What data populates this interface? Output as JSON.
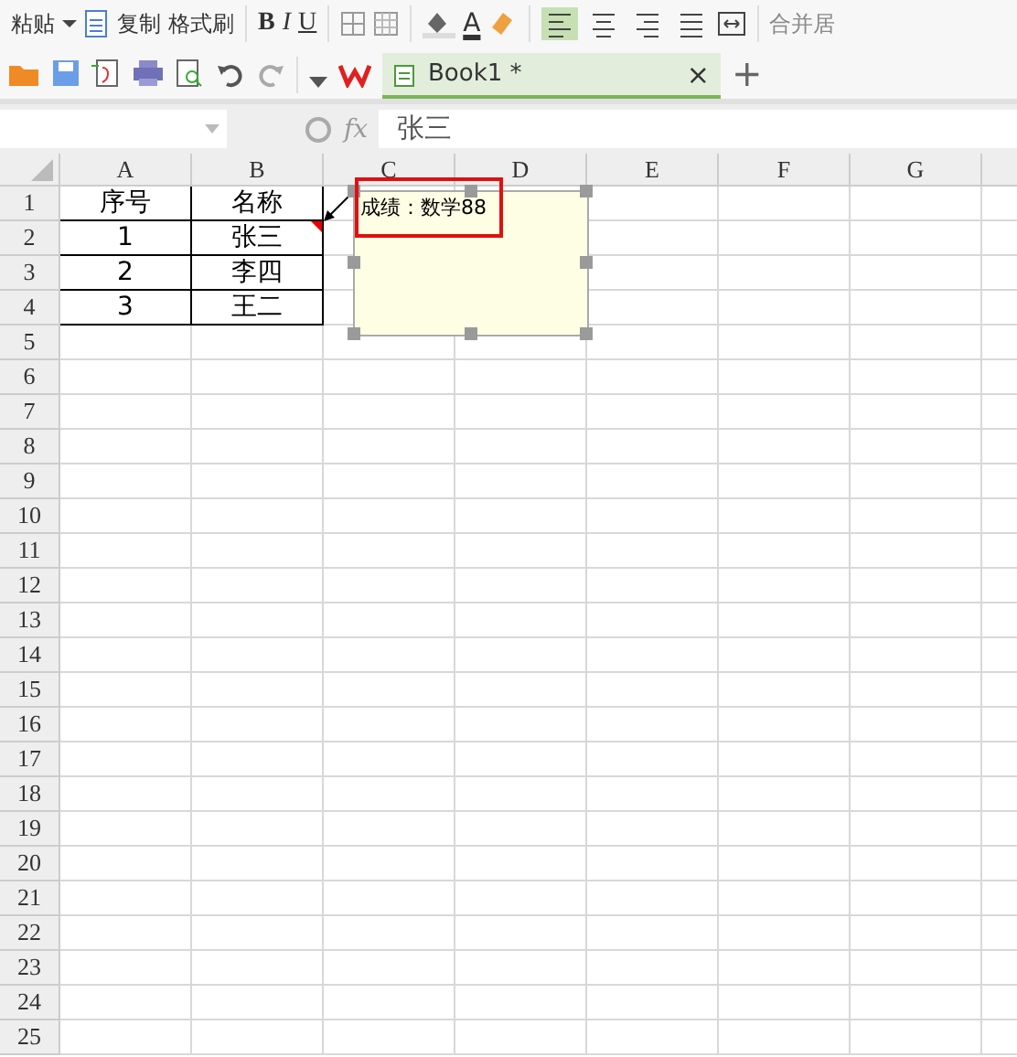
{
  "ribbon": {
    "paste": "粘贴",
    "copy": "复制",
    "format_painter": "格式刷",
    "bold": "B",
    "italic": "I",
    "underline": "U",
    "font_color": "A",
    "merge": "合并居",
    "align": [
      {
        "selected": true
      },
      {
        "selected": false
      },
      {
        "selected": false
      },
      {
        "selected": false
      }
    ]
  },
  "tabs": [
    {
      "label": "Book1 *",
      "selected": true,
      "close": "×"
    }
  ],
  "new_tab": "+",
  "formula_bar": {
    "fx": "fx",
    "value": "张三"
  },
  "columns": [
    "A",
    "B",
    "C",
    "D",
    "E",
    "F",
    "G"
  ],
  "rows": [
    {
      "number": "1",
      "cells": [
        {
          "text": "序号",
          "bordered": true
        },
        {
          "text": "名称",
          "bordered": true
        }
      ]
    },
    {
      "number": "2",
      "cells": [
        {
          "text": "1",
          "bordered": true
        },
        {
          "text": "张三",
          "bordered": true,
          "comment": true
        }
      ]
    },
    {
      "number": "3",
      "cells": [
        {
          "text": "2",
          "bordered": true
        },
        {
          "text": "李四",
          "bordered": true
        }
      ]
    },
    {
      "number": "4",
      "cells": [
        {
          "text": "3",
          "bordered": true
        },
        {
          "text": "王二",
          "bordered": true
        }
      ]
    },
    {
      "number": "5"
    },
    {
      "number": "6"
    },
    {
      "number": "7"
    },
    {
      "number": "8"
    },
    {
      "number": "9"
    },
    {
      "number": "10"
    },
    {
      "number": "11"
    },
    {
      "number": "12"
    },
    {
      "number": "13"
    },
    {
      "number": "14"
    },
    {
      "number": "15"
    },
    {
      "number": "16"
    },
    {
      "number": "17"
    },
    {
      "number": "18"
    },
    {
      "number": "19"
    },
    {
      "number": "20"
    },
    {
      "number": "21"
    },
    {
      "number": "22"
    },
    {
      "number": "23"
    },
    {
      "number": "24"
    },
    {
      "number": "25"
    }
  ],
  "comment": {
    "text": "成绩：数学88",
    "highlighted": true
  }
}
